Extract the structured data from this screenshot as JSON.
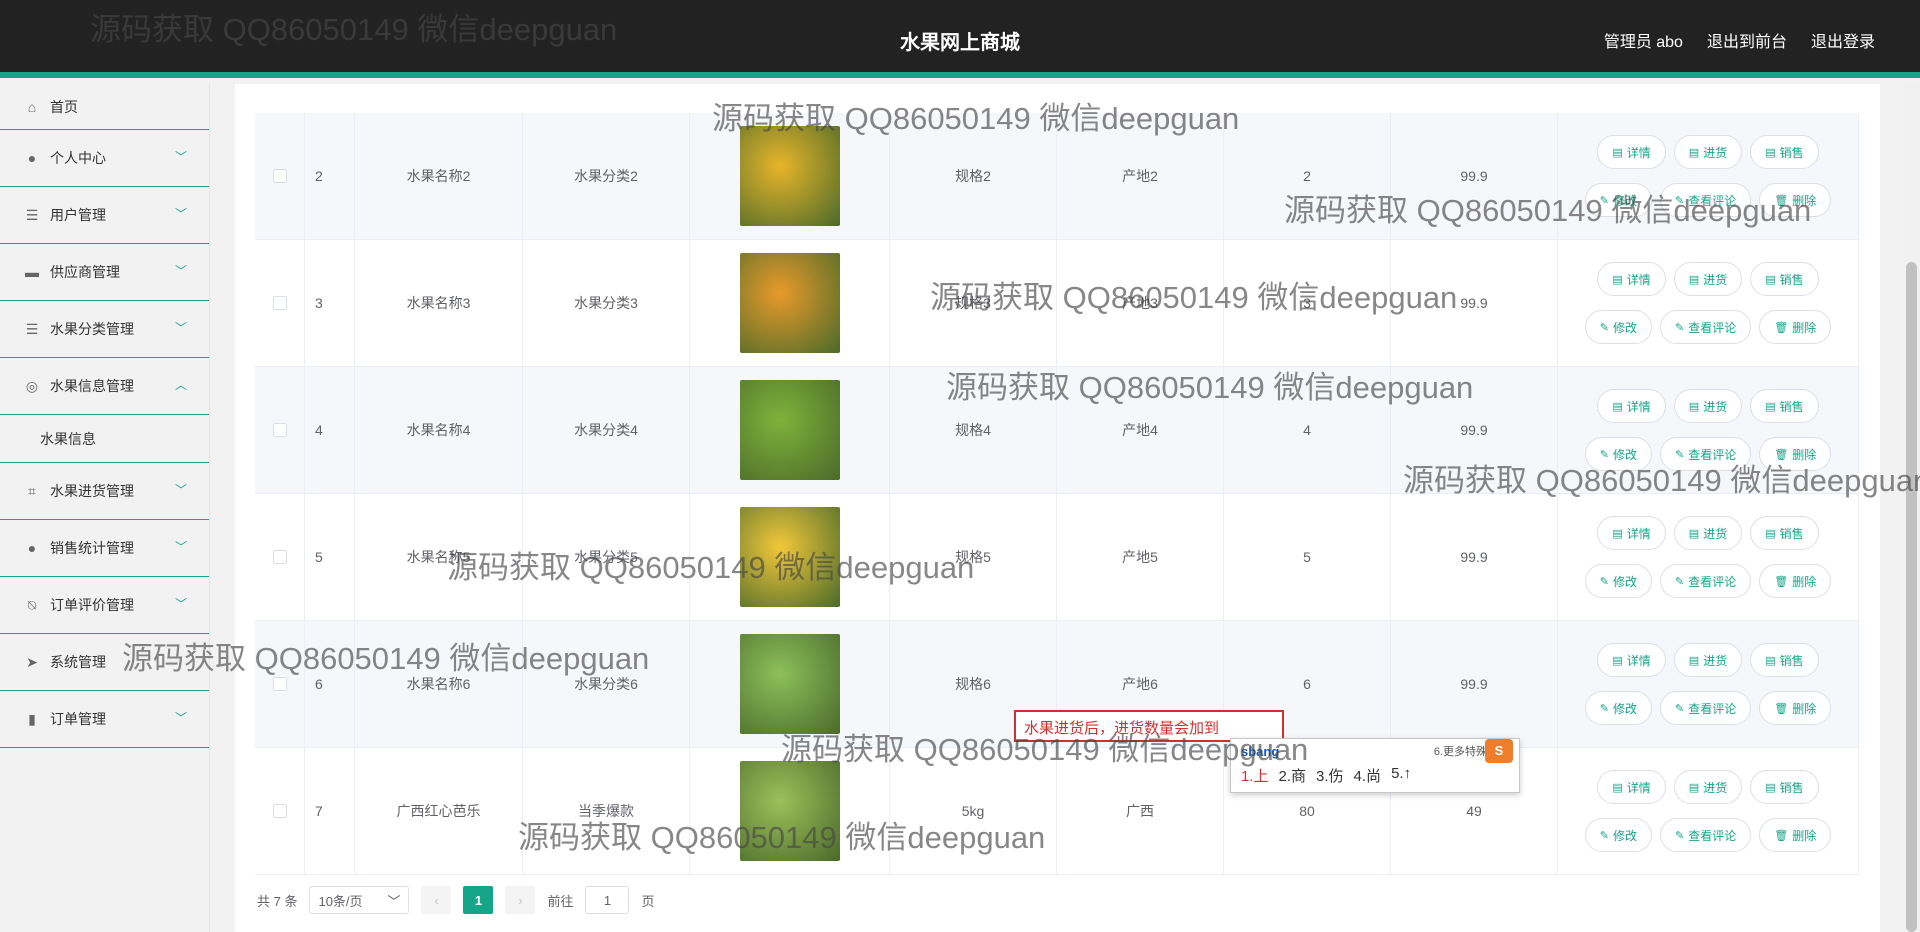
{
  "header": {
    "title": "水果网上商城",
    "admin_label": "管理员 abo",
    "to_front": "退出到前台",
    "logout": "退出登录"
  },
  "sidebar": {
    "items": [
      {
        "label": "首页",
        "icon": "home-icon"
      },
      {
        "label": "个人中心",
        "icon": "user-icon"
      },
      {
        "label": "用户管理",
        "icon": "list-icon"
      },
      {
        "label": "供应商管理",
        "icon": "box-icon"
      },
      {
        "label": "水果分类管理",
        "icon": "list-icon"
      },
      {
        "label": "水果信息管理",
        "icon": "compass-icon"
      },
      {
        "label": "水果进货管理",
        "icon": "crop-icon"
      },
      {
        "label": "销售统计管理",
        "icon": "bulb-icon"
      },
      {
        "label": "订单评价管理",
        "icon": "bell-off-icon"
      },
      {
        "label": "系统管理",
        "icon": "send-icon"
      },
      {
        "label": "订单管理",
        "icon": "bar-chart-icon"
      }
    ],
    "sub_item": "水果信息"
  },
  "table": {
    "rows": [
      {
        "idx": "2",
        "name": "水果名称2",
        "category": "水果分类2",
        "spec": "规格2",
        "origin": "产地2",
        "qty": "2",
        "price": "99.9",
        "img_color": "#e8b52a"
      },
      {
        "idx": "3",
        "name": "水果名称3",
        "category": "水果分类3",
        "spec": "规格3",
        "origin": "产地3",
        "qty": "3",
        "price": "99.9",
        "img_color": "#e89a2a"
      },
      {
        "idx": "4",
        "name": "水果名称4",
        "category": "水果分类4",
        "spec": "规格4",
        "origin": "产地4",
        "qty": "4",
        "price": "99.9",
        "img_color": "#7fb23a"
      },
      {
        "idx": "5",
        "name": "水果名称5",
        "category": "水果分类5",
        "spec": "规格5",
        "origin": "产地5",
        "qty": "5",
        "price": "99.9",
        "img_color": "#f2c83a"
      },
      {
        "idx": "6",
        "name": "水果名称6",
        "category": "水果分类6",
        "spec": "规格6",
        "origin": "产地6",
        "qty": "6",
        "price": "99.9",
        "img_color": "#8cc05a"
      },
      {
        "idx": "7",
        "name": "广西红心芭乐",
        "category": "当季爆款",
        "spec": "5kg",
        "origin": "广西",
        "qty": "80",
        "price": "49",
        "img_color": "#9cc05a"
      }
    ],
    "btn_detail": "详情",
    "btn_stock": "进货",
    "btn_sell": "销售",
    "btn_edit": "修改",
    "btn_review": "查看评论",
    "btn_delete": "删除"
  },
  "pager": {
    "total": "共 7 条",
    "page_size": "10条/页",
    "current": "1",
    "goto_prefix": "前往",
    "goto_value": "1",
    "goto_suffix": "页"
  },
  "tooltip": "水果进货后，进货数量会加到",
  "ime": {
    "composition": "sbang",
    "more": "6.更多特殊符号",
    "candidates": [
      "1.上",
      "2.商",
      "3.伤",
      "4.尚",
      "5.↑"
    ]
  },
  "watermark": "源码获取 QQ86050149 微信deepguan"
}
